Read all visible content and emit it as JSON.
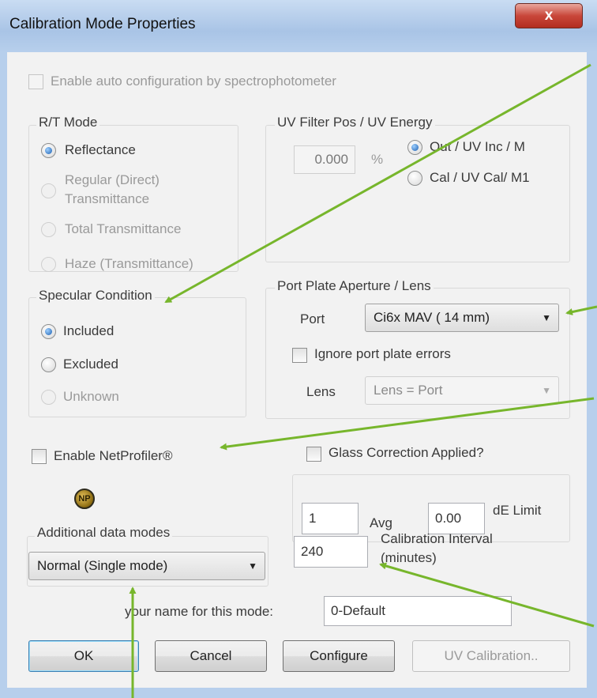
{
  "window": {
    "title": "Calibration Mode Properties",
    "close_glyph": "x"
  },
  "auto_config": {
    "label": "Enable auto configuration by spectrophotometer",
    "checked": false,
    "enabled": false
  },
  "rt_mode": {
    "legend": "R/T Mode",
    "options": [
      {
        "label": "Reflectance",
        "selected": true,
        "enabled": true
      },
      {
        "label": "Regular (Direct)",
        "label2": "Transmittance",
        "selected": false,
        "enabled": false
      },
      {
        "label": "Total Transmittance",
        "selected": false,
        "enabled": false
      },
      {
        "label": "Haze (Transmittance)",
        "selected": false,
        "enabled": false
      }
    ]
  },
  "uv_filter": {
    "legend": "UV Filter Pos / UV Energy",
    "value": "0.000",
    "unit": "%",
    "options": [
      {
        "label": "Out / UV Inc / M",
        "selected": true
      },
      {
        "label": "Cal / UV Cal/ M1",
        "selected": false
      }
    ]
  },
  "specular": {
    "legend": "Specular Condition",
    "options": [
      {
        "label": "Included",
        "selected": true,
        "enabled": true
      },
      {
        "label": "Excluded",
        "selected": false,
        "enabled": true
      },
      {
        "label": "Unknown",
        "selected": false,
        "enabled": false
      }
    ]
  },
  "port_plate": {
    "legend": "Port Plate Aperture / Lens",
    "port_label": "Port",
    "port_value": "Ci6x MAV ( 14 mm)",
    "ignore_errors_label": "Ignore port plate errors",
    "ignore_errors_checked": false,
    "lens_label": "Lens",
    "lens_value": "Lens = Port"
  },
  "netprofiler": {
    "label": "Enable NetProfiler®",
    "checked": false,
    "icon": "netprofiler-icon",
    "icon_text": "NP"
  },
  "glass_correction": {
    "label": "Glass Correction Applied?",
    "checked": false
  },
  "averaging": {
    "avg_value": "1",
    "avg_label": "Avg",
    "de_value": "0.00",
    "de_label": "dE Limit"
  },
  "additional_modes": {
    "label": "Additional data modes",
    "value": "Normal (Single mode)"
  },
  "calibration_interval": {
    "value": "240",
    "label_line1": "Calibration Interval",
    "label_line2": "(minutes)"
  },
  "mode_name": {
    "label": "your name for this mode:",
    "value": "0-Default"
  },
  "buttons": {
    "ok": "OK",
    "cancel": "Cancel",
    "configure": "Configure",
    "uv_calibration": "UV Calibration.."
  },
  "colors": {
    "annotation_arrow": "#77b62c",
    "title_bar": "#b7cfec",
    "dialog_bg": "#f2f2f2",
    "close_button": "#c9473a"
  }
}
